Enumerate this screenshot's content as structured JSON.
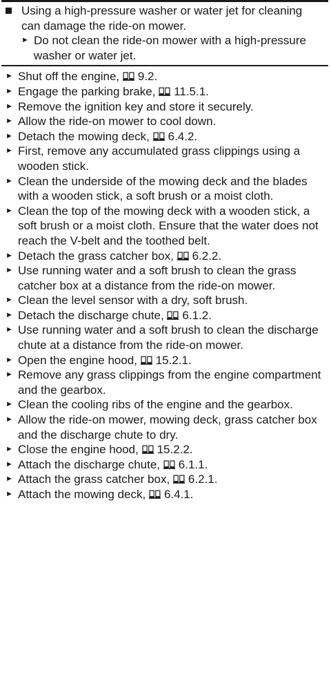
{
  "notice": {
    "text": "Using a high-pressure washer or water jet for cleaning can damage the ride-on mower.",
    "instruction": "Do not clean the ride-on mower with a high-pressure washer or water jet."
  },
  "steps": [
    {
      "text": "Shut off the engine,",
      "ref": "9.2."
    },
    {
      "text": "Engage the parking brake,",
      "ref": "11.5.1."
    },
    {
      "text": "Remove the ignition key and store it securely."
    },
    {
      "text": "Allow the ride-on mower to cool down."
    },
    {
      "text": "Detach the mowing deck,",
      "ref": "6.4.2."
    },
    {
      "text": "First, remove any accumulated grass clippings using a wooden stick."
    },
    {
      "text": "Clean the underside of the mowing deck and the blades with a wooden stick, a soft brush or a moist cloth."
    },
    {
      "text": "Clean the top of the mowing deck with a wooden stick, a soft brush or a moist cloth. Ensure that the water does not reach the V-belt and the toothed belt."
    },
    {
      "text": "Detach the grass catcher box,",
      "ref": "6.2.2."
    },
    {
      "text": "Use running water and a soft brush to clean the grass catcher box at a distance from the ride-on mower."
    },
    {
      "text": "Clean the level sensor with a dry, soft brush."
    },
    {
      "text": "Detach the discharge chute,",
      "ref": "6.1.2."
    },
    {
      "text": "Use running water and a soft brush to clean the discharge chute at a distance from the ride-on mower."
    },
    {
      "text": "Open the engine hood,",
      "ref": "15.2.1."
    },
    {
      "text": "Remove any grass clippings from the engine compartment and the gearbox."
    },
    {
      "text": "Clean the cooling ribs of the engine and the gearbox."
    },
    {
      "text": "Allow the ride-on mower, mowing deck, grass catcher box and the discharge chute to dry."
    },
    {
      "text": "Close the engine hood,",
      "ref": "15.2.2."
    },
    {
      "text": "Attach the discharge chute,",
      "ref": "6.1.1."
    },
    {
      "text": "Attach the grass catcher box,",
      "ref": "6.2.1."
    },
    {
      "text": "Attach the mowing deck,",
      "ref": "6.4.1."
    }
  ],
  "icons": {
    "bullet": "triangle-bullet-icon",
    "notice_bullet": "square-bullet-icon",
    "reference": "book-icon"
  }
}
